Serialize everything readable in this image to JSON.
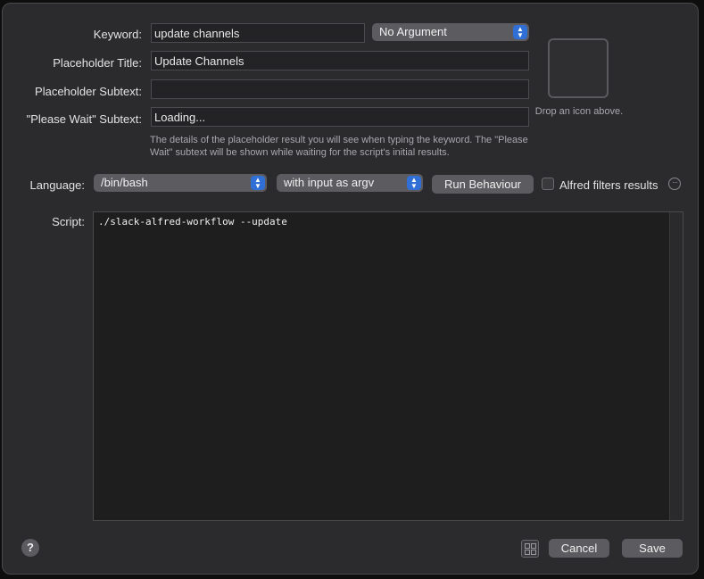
{
  "form": {
    "keyword_label": "Keyword:",
    "keyword_value": "update channels",
    "argument_option": "No Argument",
    "placeholder_title_label": "Placeholder Title:",
    "placeholder_title_value": "Update Channels",
    "placeholder_subtext_label": "Placeholder Subtext:",
    "placeholder_subtext_value": "",
    "please_wait_label": "\"Please Wait\" Subtext:",
    "please_wait_value": "Loading...",
    "help_text": "The details of the placeholder result you will see when typing the keyword. The \"Please Wait\" subtext will be shown while waiting for the script's initial results."
  },
  "icon_well": {
    "caption": "Drop an icon above."
  },
  "script_settings": {
    "language_label": "Language:",
    "language_value": "/bin/bash",
    "input_mode_value": "with input as argv",
    "run_behaviour_label": "Run Behaviour",
    "alfred_filters_label": "Alfred filters results",
    "alfred_filters_checked": false
  },
  "script": {
    "label": "Script:",
    "content": "./slack-alfred-workflow --update"
  },
  "footer": {
    "help_label": "?",
    "cancel_label": "Cancel",
    "save_label": "Save"
  },
  "colors": {
    "accent": "#2f6fd6",
    "window_bg": "#2b2b2e",
    "script_bg": "#1e1e1e"
  }
}
